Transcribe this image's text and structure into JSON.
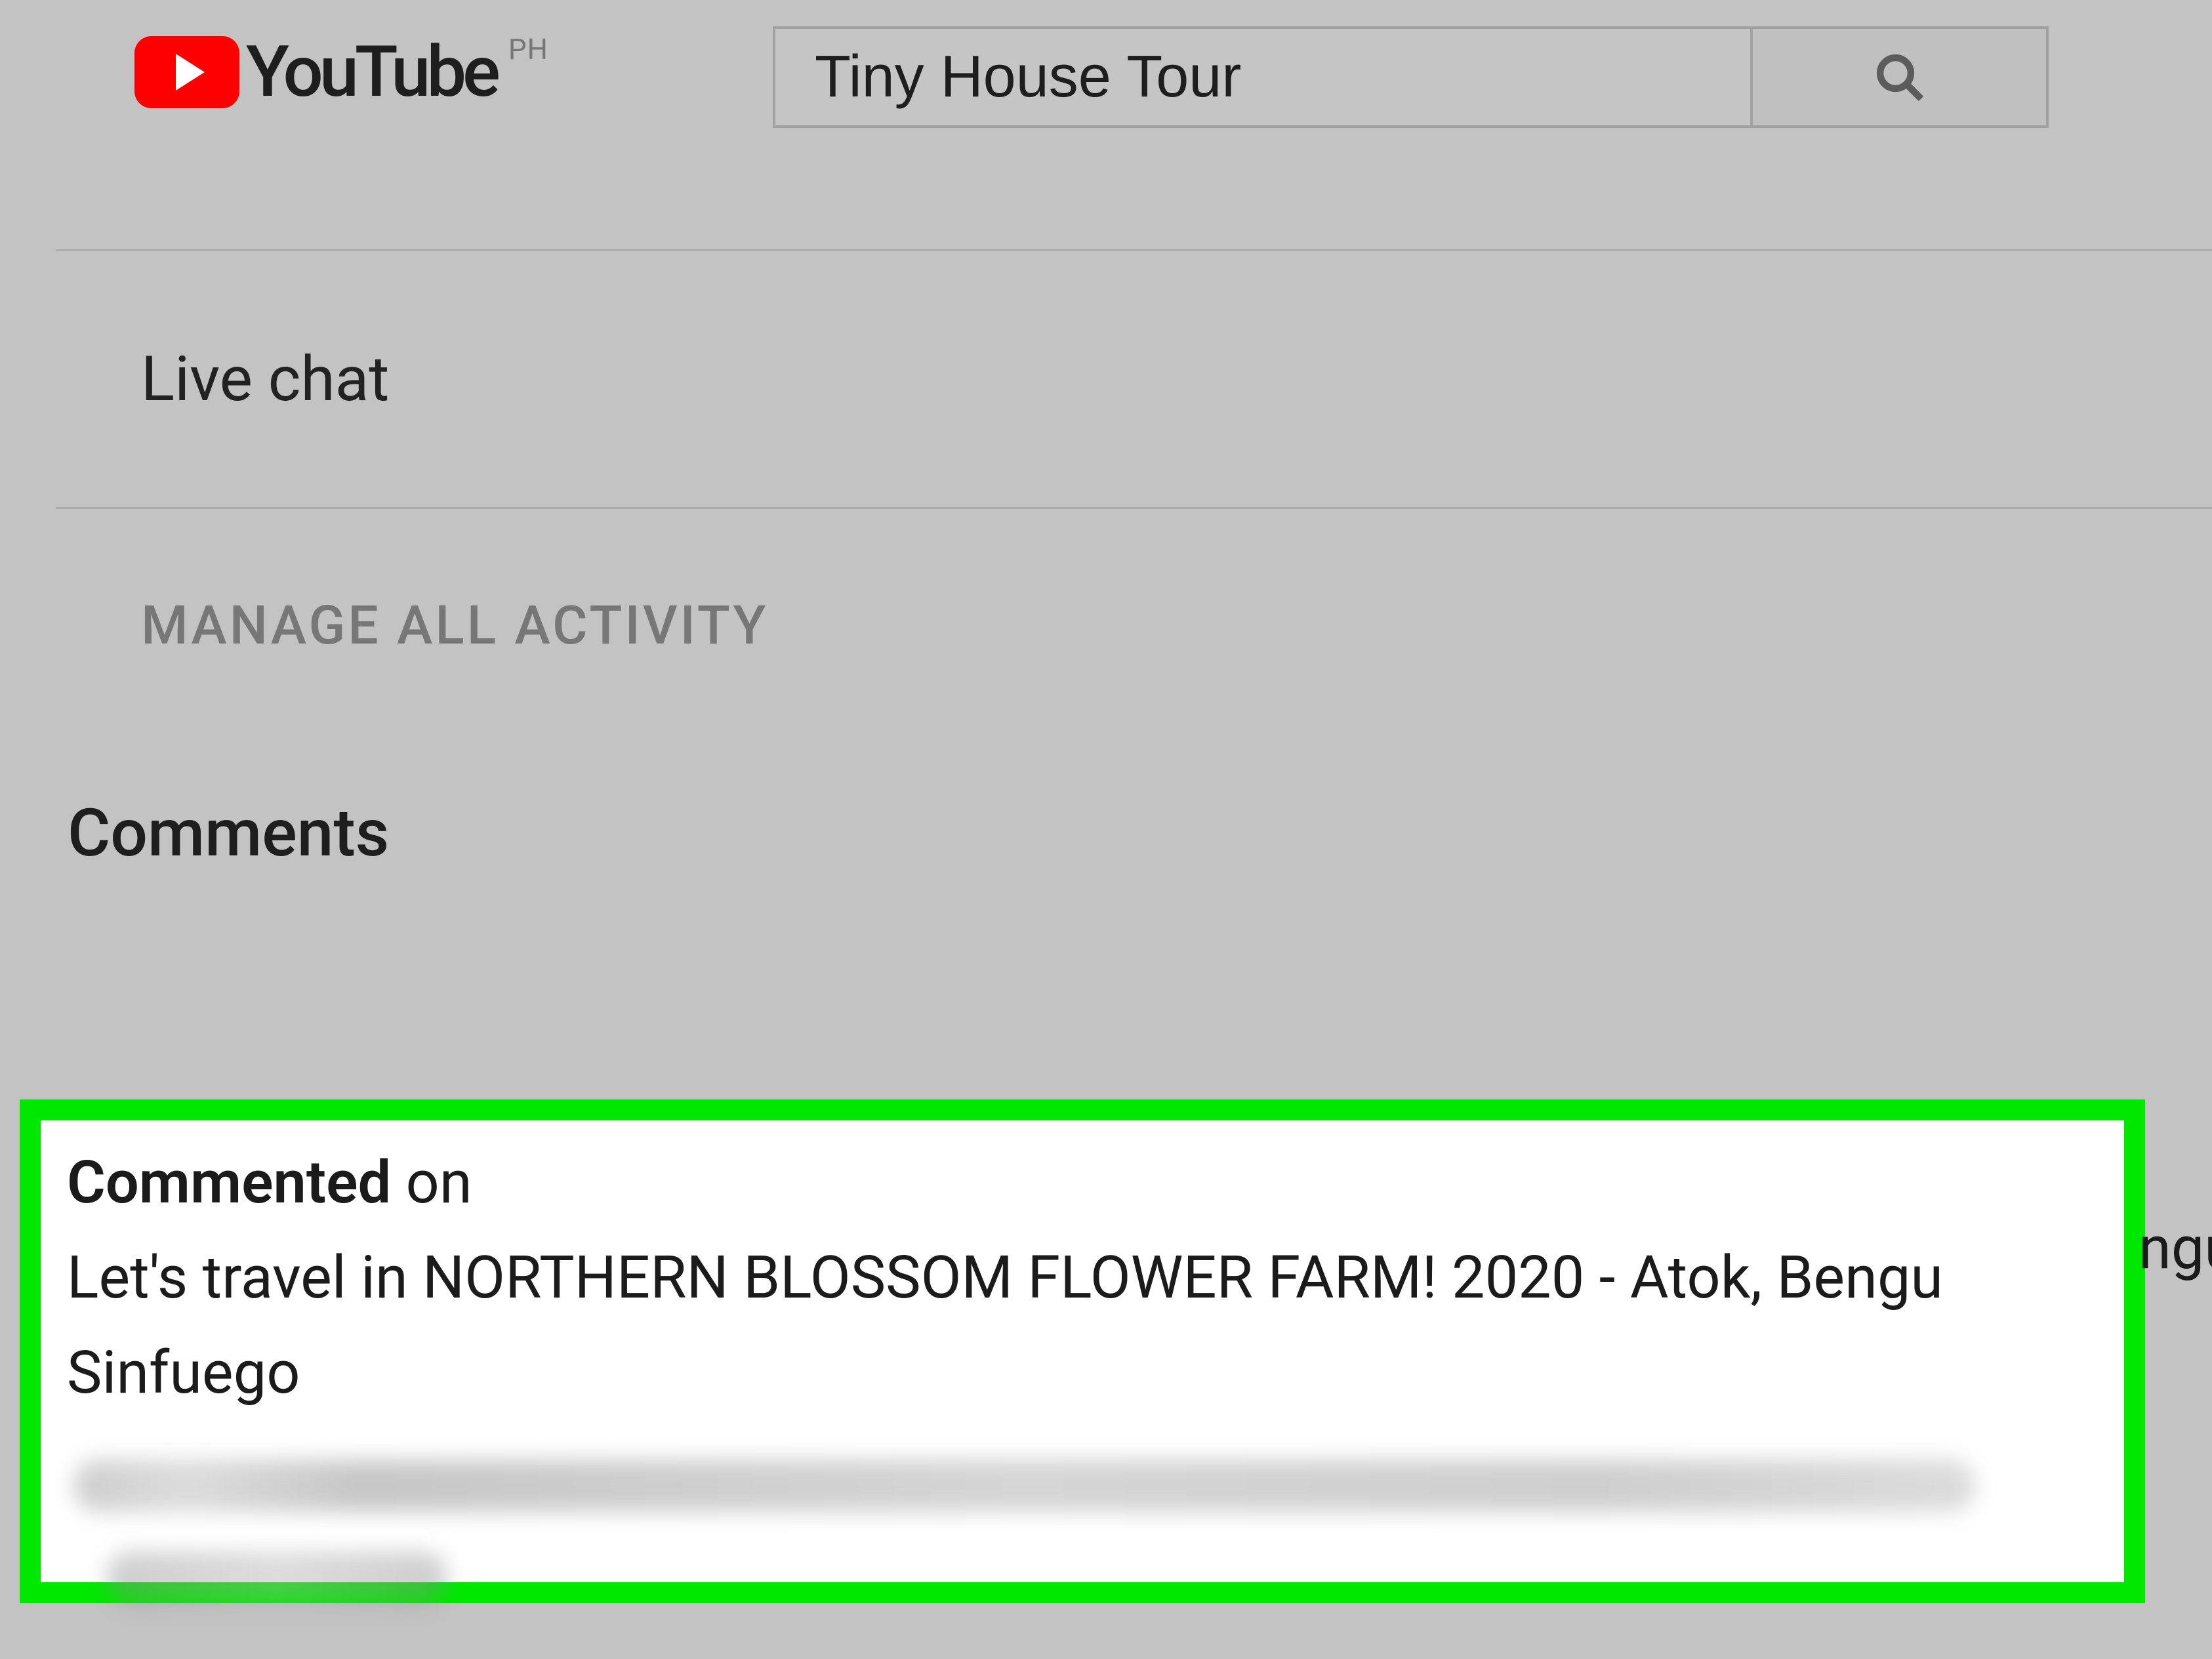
{
  "header": {
    "wordmark": "YouTube",
    "country_code": "PH",
    "search_value": "Tiny House Tour"
  },
  "sidebar": {
    "live_chat_label": "Live chat",
    "manage_link_label": "MANAGE ALL ACTIVITY"
  },
  "section": {
    "comments_heading": "Comments"
  },
  "comment": {
    "action_word": "Commented",
    "action_suffix": " on",
    "video_title": "Let's travel in NORTHERN BLOSSOM FLOWER FARM! 2020 - Atok, Bengu",
    "video_title_overflow": "ngu",
    "channel_name": "Sinfuego"
  }
}
